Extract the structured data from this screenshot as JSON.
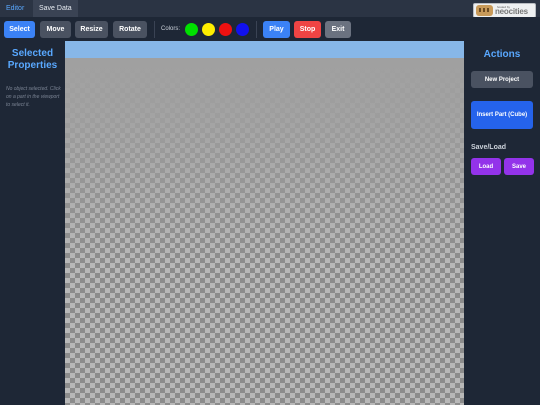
{
  "tabs": [
    {
      "label": "Editor"
    },
    {
      "label": "Save Data"
    }
  ],
  "badge": {
    "small_text": "hosted by",
    "text": "neocities"
  },
  "toolbar": {
    "tools": [
      {
        "label": "Select",
        "active": true
      },
      {
        "label": "Move"
      },
      {
        "label": "Resize"
      },
      {
        "label": "Rotate"
      }
    ],
    "colors_label": "Colors:",
    "colors": [
      "#00e000",
      "#ffee00",
      "#ee1111",
      "#1111ee"
    ],
    "play_label": "Play",
    "stop_label": "Stop",
    "exit_label": "Exit"
  },
  "left_panel": {
    "title": "Selected Properties",
    "hint": "No object selected. Click on a part in the viewport to select it."
  },
  "right_panel": {
    "title": "Actions",
    "new_project_label": "New Project",
    "insert_part_label": "Insert Part (Cube)",
    "save_load_label": "Save/Load",
    "load_label": "Load",
    "save_label": "Save"
  },
  "theme": {
    "accent": "#59a8ff",
    "primary": "#3b82f6",
    "danger": "#ef4444",
    "purple": "#9333ea",
    "bg": "#1e2736"
  }
}
